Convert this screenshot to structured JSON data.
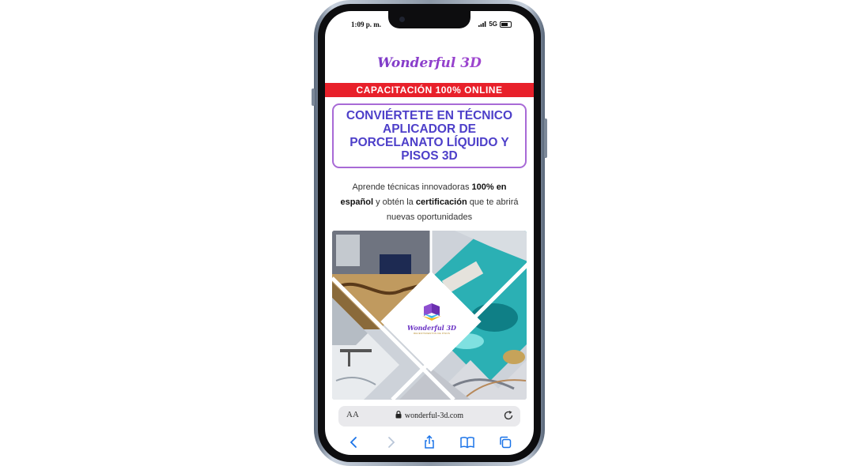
{
  "status_bar": {
    "time": "1:09 p. m.",
    "network": "5G"
  },
  "page": {
    "brand": "Wonderful 3D",
    "promo_banner": "CAPACITACIÓN 100% ONLINE",
    "headline": "CONVIÉRTETE EN TÉCNICO APLICADOR DE PORCELANATO LÍQUIDO Y PISOS 3D",
    "subtext": {
      "part1": "Aprende técnicas innovadoras ",
      "bold1": "100% en español",
      "part2": " y obtén la ",
      "bold2": "certificación",
      "part3": " que te abrirá nuevas oportunidades"
    },
    "hero": {
      "logo_text": "Wonderful 3D",
      "logo_tagline": "REVESTIMIENTOS DE PISOS"
    }
  },
  "browser": {
    "aa_label": "AA",
    "url": "wonderful-3d.com"
  },
  "icons": {
    "lock": "lock-icon",
    "reload": "reload-icon",
    "back": "back-icon",
    "forward": "forward-icon",
    "share": "share-icon",
    "bookmarks": "bookmarks-icon",
    "tabs": "tabs-icon"
  },
  "colors": {
    "brand_purple": "#6b33c4",
    "headline_blue": "#4d3fc9",
    "banner_red": "#e8202a",
    "ios_blue": "#1a73e8"
  }
}
